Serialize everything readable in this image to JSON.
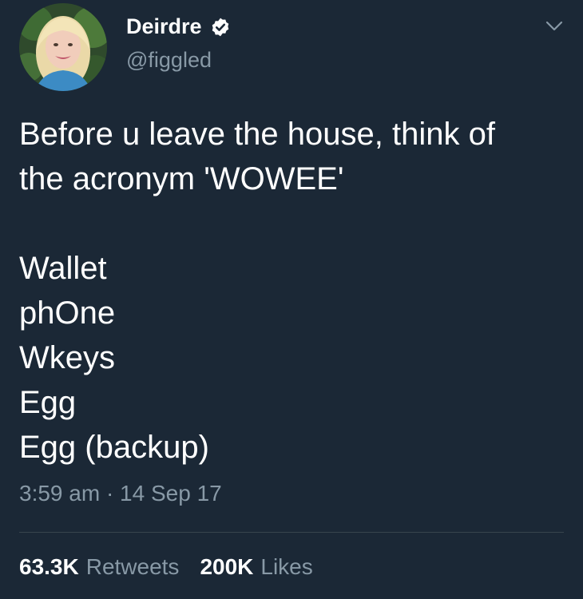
{
  "author": {
    "display_name": "Deirdre",
    "handle": "@figgled",
    "verified": true,
    "verified_icon": "verified-badge-icon"
  },
  "menu_icon": "chevron-down-icon",
  "tweet": {
    "lines": [
      "Before u leave the house, think of",
      "the acronym 'WOWEE'",
      "",
      "Wallet",
      "phOne",
      "Wkeys",
      "Egg",
      "Egg (backup)"
    ]
  },
  "meta": {
    "timestamp": "3:59 am · 14 Sep 17"
  },
  "stats": {
    "retweets_count": "63.3K",
    "retweets_label": "Retweets",
    "likes_count": "200K",
    "likes_label": "Likes"
  },
  "colors": {
    "background": "#1b2836",
    "primary_text": "#ffffff",
    "secondary_text": "#8899a6",
    "divider": "#38444d"
  }
}
